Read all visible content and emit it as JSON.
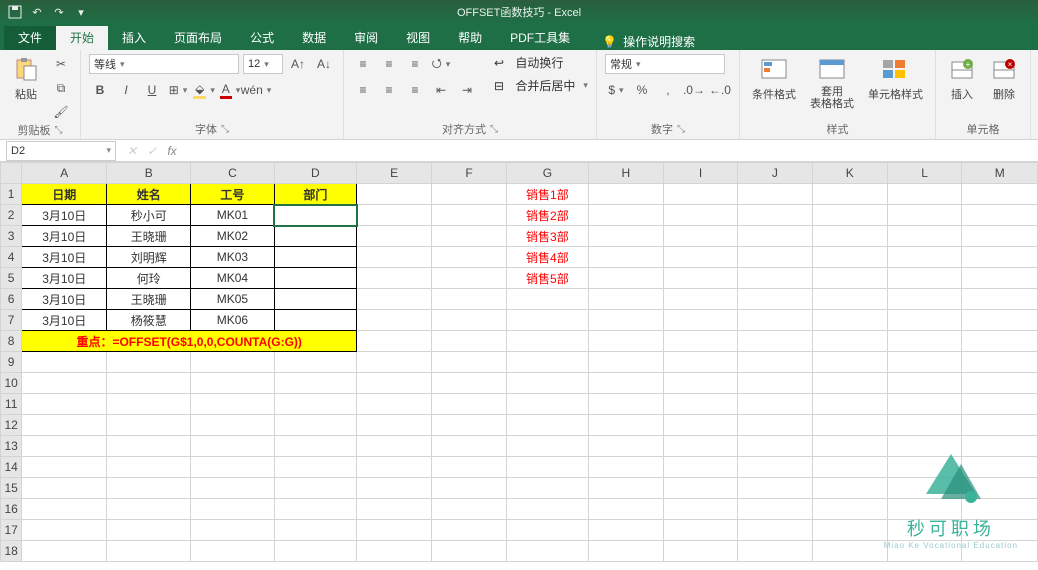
{
  "title": "OFFSET函数技巧 - Excel",
  "tabs": {
    "file": "文件",
    "home": "开始",
    "insert": "插入",
    "layout": "页面布局",
    "formulas": "公式",
    "data": "数据",
    "review": "审阅",
    "view": "视图",
    "help": "帮助",
    "pdf": "PDF工具集",
    "tellme": "操作说明搜索"
  },
  "ribbon": {
    "clipboard": {
      "paste": "粘贴",
      "label": "剪贴板"
    },
    "font": {
      "name": "等线",
      "size": "12",
      "label": "字体",
      "bold": "B",
      "italic": "I",
      "underline": "U"
    },
    "align": {
      "wrap": "自动换行",
      "merge": "合并后居中",
      "label": "对齐方式"
    },
    "number": {
      "format": "常规",
      "label": "数字"
    },
    "styles": {
      "cond": "条件格式",
      "table": "套用\n表格格式",
      "cell": "单元格样式",
      "label": "样式"
    },
    "cells": {
      "insert": "插入",
      "delete": "删除",
      "label": "单元格"
    }
  },
  "namebox": "D2",
  "formula_bar": "",
  "columns": [
    "A",
    "B",
    "C",
    "D",
    "E",
    "F",
    "G",
    "H",
    "I",
    "J",
    "K",
    "L",
    "M"
  ],
  "headers": {
    "A": "日期",
    "B": "姓名",
    "C": "工号",
    "D": "部门"
  },
  "rows": [
    {
      "A": "3月10日",
      "B": "秒小可",
      "C": "MK01",
      "D": ""
    },
    {
      "A": "3月10日",
      "B": "王晓珊",
      "C": "MK02",
      "D": ""
    },
    {
      "A": "3月10日",
      "B": "刘明辉",
      "C": "MK03",
      "D": ""
    },
    {
      "A": "3月10日",
      "B": "何玲",
      "C": "MK04",
      "D": ""
    },
    {
      "A": "3月10日",
      "B": "王晓珊",
      "C": "MK05",
      "D": ""
    },
    {
      "A": "3月10日",
      "B": "杨筱慧",
      "C": "MK06",
      "D": ""
    }
  ],
  "formula_row": "重点：=OFFSET(G$1,0,0,COUNTA(G:G))",
  "gcol": [
    "销售1部",
    "销售2部",
    "销售3部",
    "销售4部",
    "销售5部"
  ],
  "logo": {
    "text": "秒可职场",
    "sub": "Miao Ke Vocational Education"
  }
}
